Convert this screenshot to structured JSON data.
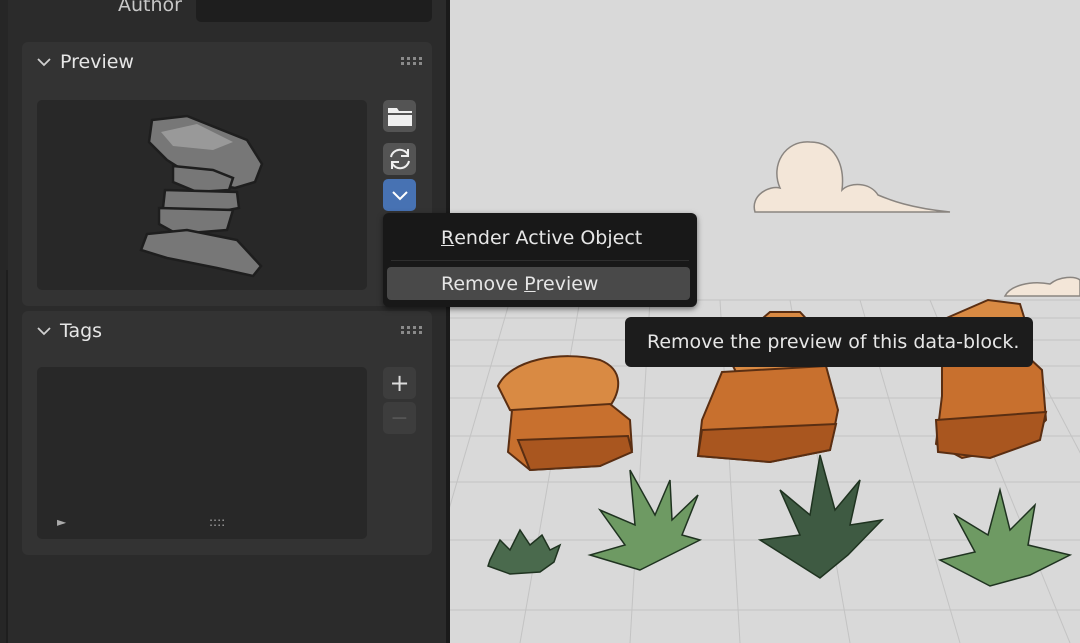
{
  "properties": {
    "author": {
      "label": "Author",
      "value": ""
    },
    "preview_panel": {
      "title": "Preview",
      "buttons": {
        "load_icon": "folder-icon",
        "refresh_icon": "refresh-icon",
        "menu_icon": "chevron-down-icon"
      }
    },
    "tags_panel": {
      "title": "Tags",
      "buttons": {
        "add": "+",
        "remove": "−"
      },
      "list_play_glyph": "►",
      "list_grip_glyph": "::::"
    }
  },
  "context_menu": {
    "items": [
      {
        "label": "Render Active Object",
        "mnemonic": "R",
        "rest": "ender Active Object",
        "highlighted": false
      },
      {
        "label": "Remove Preview",
        "prefix": "Remove ",
        "mnemonic": "P",
        "rest": "review",
        "highlighted": true
      }
    ]
  },
  "tooltip": {
    "text": "Remove the preview of this data-block."
  },
  "colors": {
    "panel_bg": "#333333",
    "editor_bg": "#2b2b2b",
    "active_button": "#4772b3",
    "viewport_bg": "#d9d9d9",
    "rock": "#c8702e",
    "grass": "#5e8a57"
  }
}
